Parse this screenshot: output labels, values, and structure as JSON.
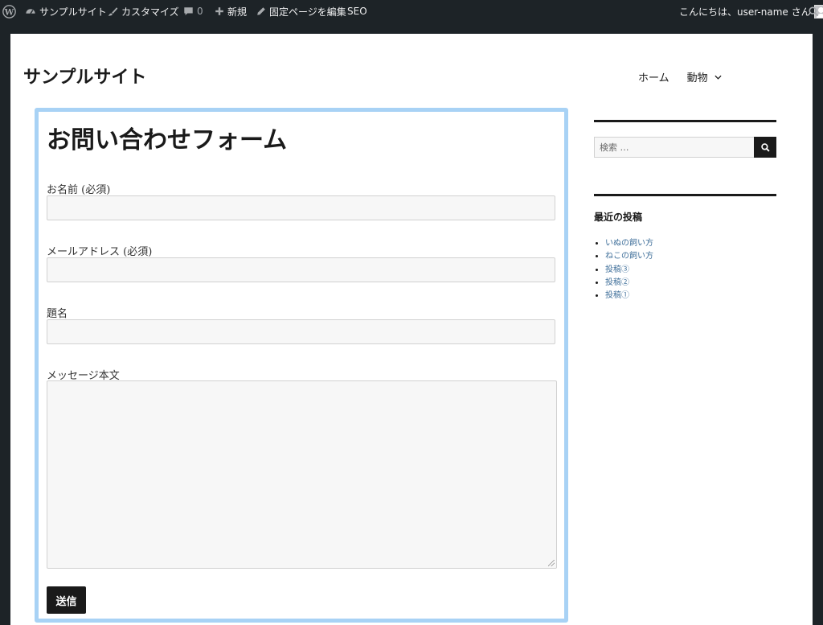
{
  "adminbar": {
    "site_name": "サンプルサイト",
    "customize": "カスタマイズ",
    "comments_count": "0",
    "new": "新規",
    "edit_page": "固定ページを編集",
    "seo": "SEO",
    "greeting": "こんにちは、user-name さん"
  },
  "site": {
    "title": "サンプルサイト",
    "nav": {
      "home": "ホーム",
      "animals": "動物"
    }
  },
  "content": {
    "page_title": "お問い合わせフォーム",
    "form": {
      "name_label": "お名前 (必須)",
      "email_label": "メールアドレス (必須)",
      "subject_label": "題名",
      "message_label": "メッセージ本文",
      "submit_label": "送信"
    }
  },
  "sidebar": {
    "search_placeholder": "検索 …",
    "recent_title": "最近の投稿",
    "recent_posts": [
      "いぬの飼い方",
      "ねこの飼い方",
      "投稿③",
      "投稿②",
      "投稿①"
    ]
  },
  "colors": {
    "admin_bar": "#1d2327",
    "content_border": "#a8d2f5",
    "link": "#3f6f9a"
  }
}
